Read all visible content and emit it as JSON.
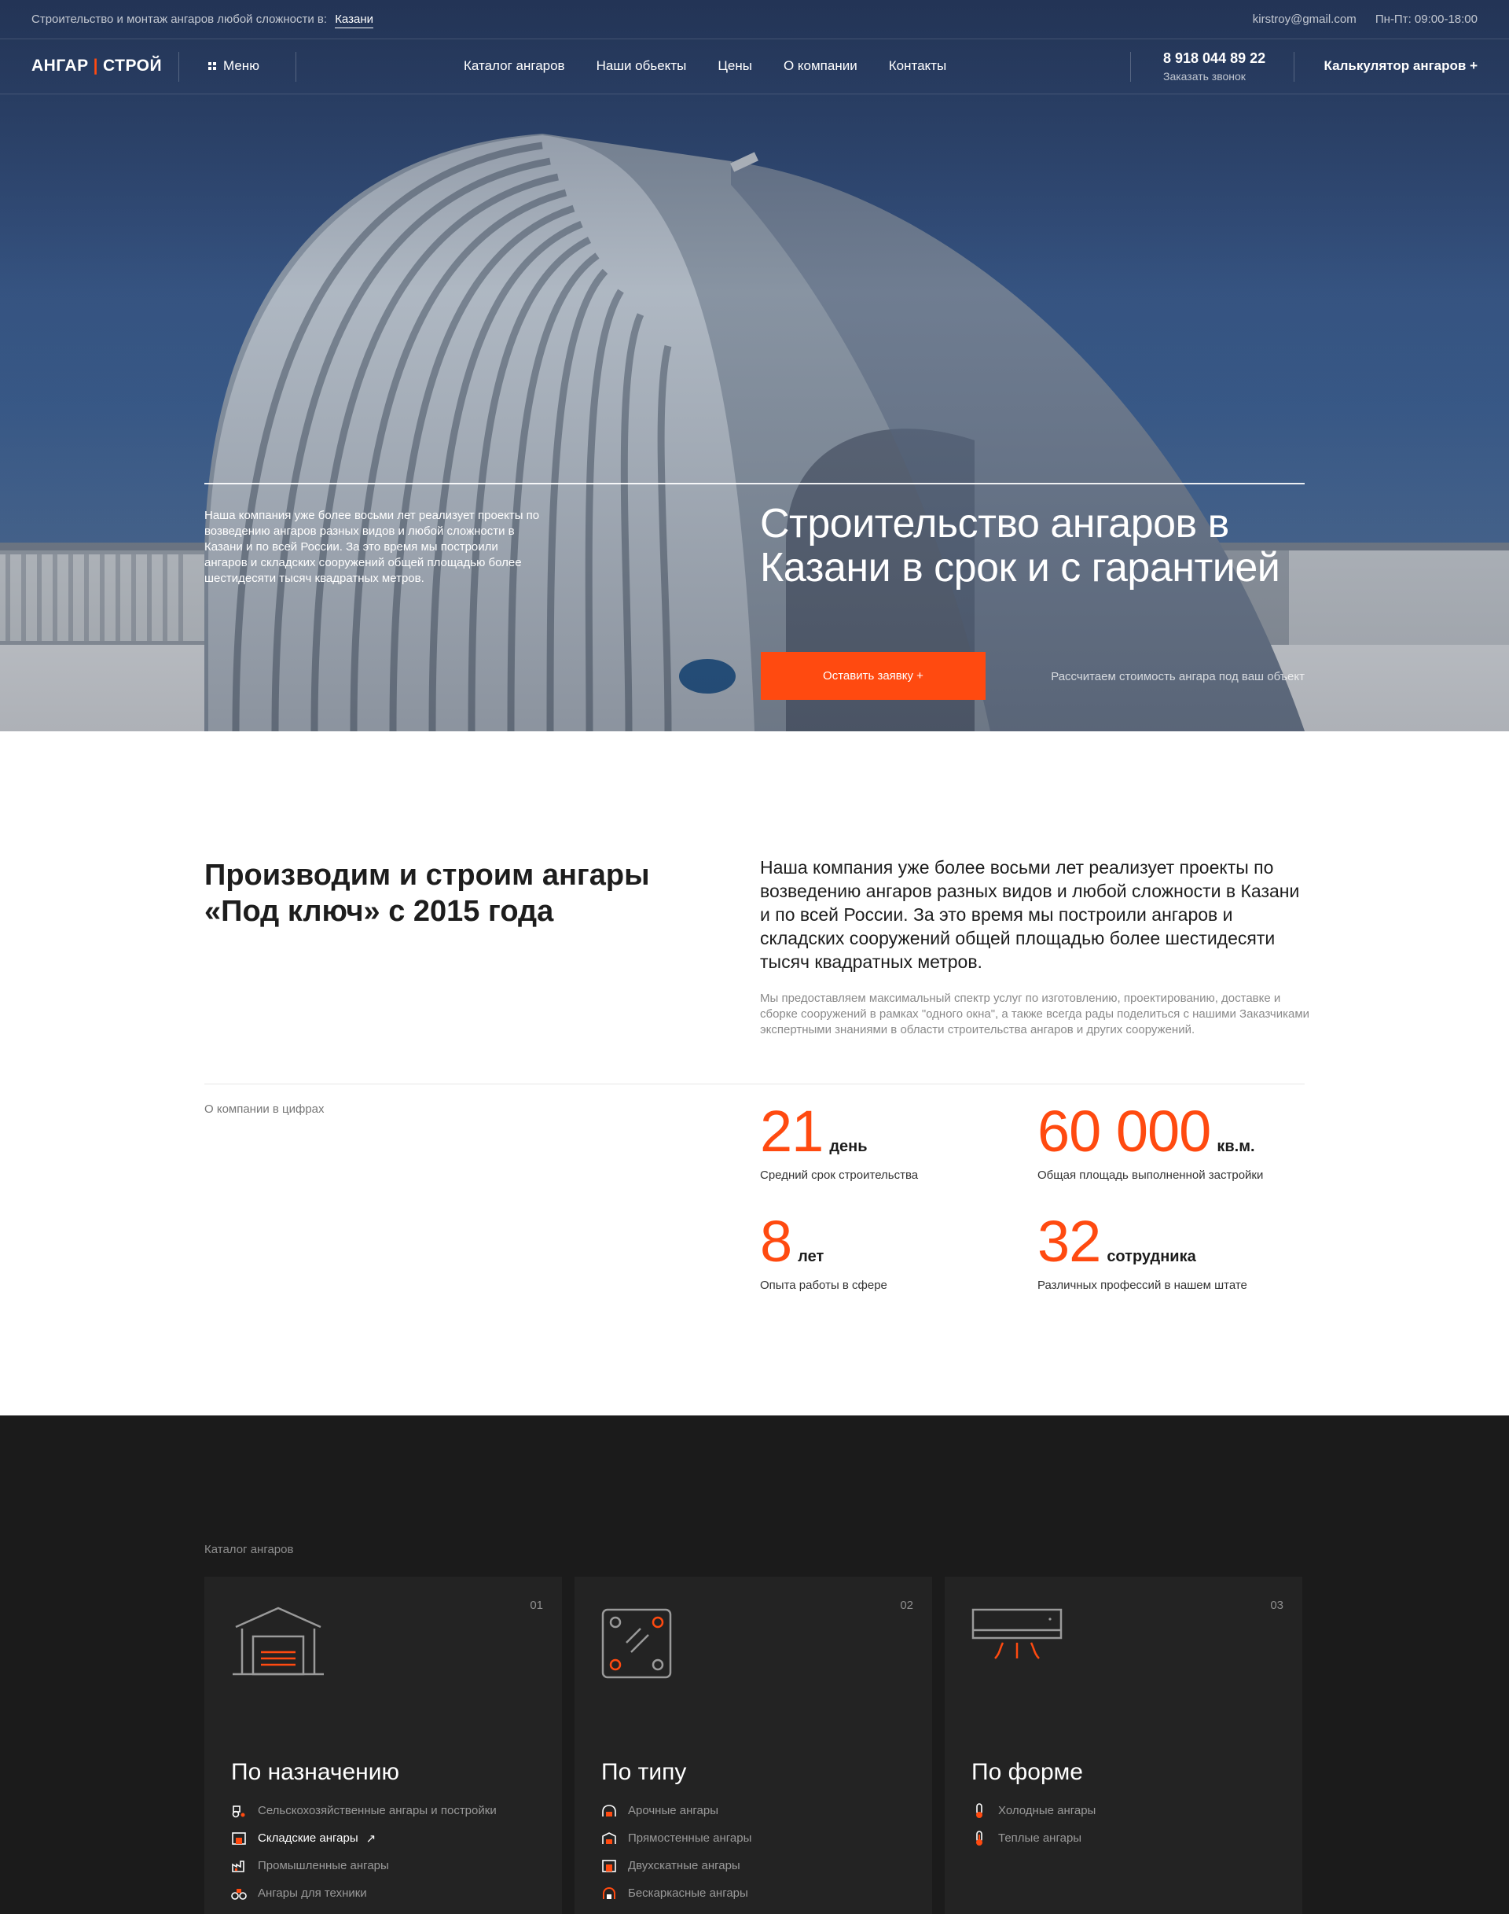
{
  "topbar": {
    "tagline": "Строительство и монтаж ангаров любой сложности в:",
    "city": "Казани",
    "email": "kirstroy@gmail.com",
    "hours": "Пн-Пт: 09:00-18:00"
  },
  "header": {
    "logo_left": "АНГАР",
    "logo_right": "СТРОЙ",
    "menu_label": "Меню",
    "nav": [
      "Каталог ангаров",
      "Наши обьекты",
      "Цены",
      "О компании",
      "Контакты"
    ],
    "phone": "8 918 044 89 22",
    "callback": "Заказать звонок",
    "calculator": "Калькулятор ангаров +"
  },
  "hero": {
    "description": "Наша компания уже более восьми лет реализует проекты по возведению ангаров разных видов и любой сложности в Казани и по всей России. За это время мы построили ангаров и складских сооружений общей площадью более шестидесяти тысяч квадратных метров.",
    "title": "Строительство ангаров в Казани в срок и с гарантией",
    "cta": "Оставить заявку +",
    "note": "Рассчитаем стоимость ангара под ваш объект"
  },
  "about": {
    "title": "Производим и строим ангары «Под ключ» с 2015 года",
    "lead": "Наша компания уже более восьми лет реализует проекты по возведению ангаров разных видов и любой сложности в Казани и по всей России. За это время мы построили ангаров и складских сооружений общей площадью более шестидесяти тысяч квадратных метров.",
    "small": "Мы предоставляем максимальный спектр услуг  по изготовлению, проектированию, доставке и сборке сооружений в рамках \"одного окна\", а также всегда рады поделиться с нашими Заказчиками экспертными знаниями в области строительства ангаров и других сооружений.",
    "stats_label": "О компании в цифрах",
    "stats": [
      {
        "value": "21",
        "unit": "день",
        "caption": "Средний срок строительства"
      },
      {
        "value": "60 000",
        "unit": "кв.м.",
        "caption": "Общая площадь выполненной застройки"
      },
      {
        "value": "8",
        "unit": "лет",
        "caption": "Опыта работы в сфере"
      },
      {
        "value": "32",
        "unit": "сотрудника",
        "caption": "Различных профессий в нашем штате"
      }
    ]
  },
  "catalog": {
    "label": "Каталог ангаров",
    "cards": [
      {
        "index": "01",
        "title": "По назначению",
        "icon": "garage-icon",
        "items": [
          {
            "label": "Сельскохозяйственные ангары и постройки",
            "icon": "tractor-icon"
          },
          {
            "label": "Складские ангары",
            "icon": "warehouse-icon",
            "active": true
          },
          {
            "label": "Промышленные ангары",
            "icon": "factory-icon"
          },
          {
            "label": "Ангары для техники",
            "icon": "machinery-icon"
          }
        ]
      },
      {
        "index": "02",
        "title": "По типу",
        "icon": "panel-icon",
        "items": [
          {
            "label": "Арочные ангары",
            "icon": "arch-icon"
          },
          {
            "label": "Прямостенные ангары",
            "icon": "straight-wall-icon"
          },
          {
            "label": "Двухскатные ангары",
            "icon": "gable-icon"
          },
          {
            "label": "Бескаркасные ангары",
            "icon": "frameless-icon"
          }
        ]
      },
      {
        "index": "03",
        "title": "По форме",
        "icon": "air-conditioner-icon",
        "items": [
          {
            "label": "Холодные ангары",
            "icon": "thermometer-cold-icon"
          },
          {
            "label": "Теплые ангары",
            "icon": "thermometer-warm-icon"
          }
        ]
      }
    ]
  },
  "colors": {
    "accent": "#ff4a10",
    "dark": "#1b1b1b",
    "card": "#232323"
  }
}
